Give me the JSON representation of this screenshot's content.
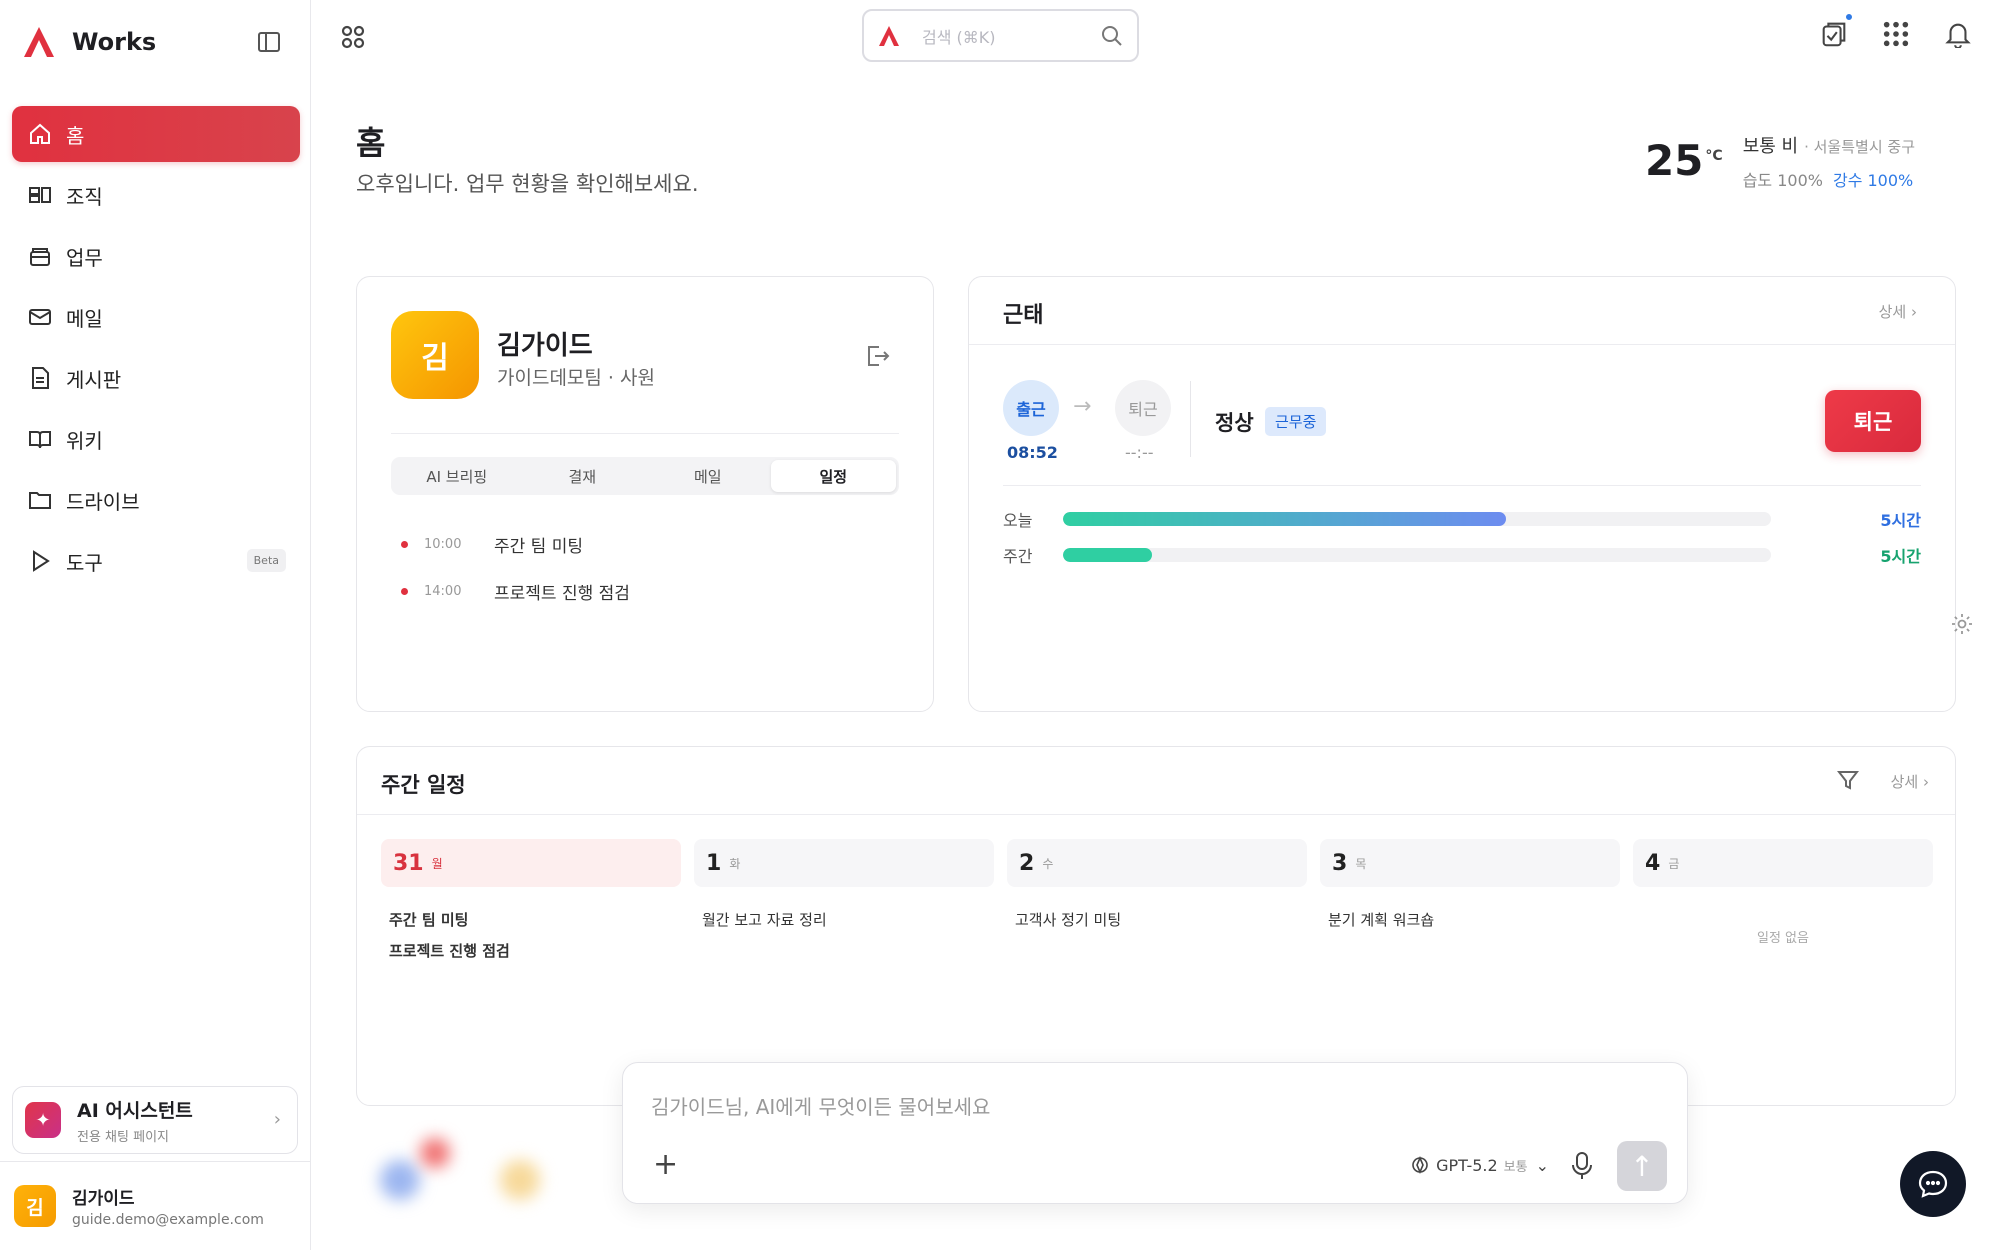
{
  "app": {
    "name": "Works"
  },
  "sidebar": {
    "items": [
      {
        "label": "홈",
        "icon": "home-icon",
        "active": true
      },
      {
        "label": "조직",
        "icon": "org-icon"
      },
      {
        "label": "업무",
        "icon": "task-icon"
      },
      {
        "label": "메일",
        "icon": "mail-icon"
      },
      {
        "label": "게시판",
        "icon": "board-icon"
      },
      {
        "label": "위키",
        "icon": "wiki-icon"
      },
      {
        "label": "드라이브",
        "icon": "folder-icon"
      },
      {
        "label": "도구",
        "icon": "play-icon",
        "badge": "Beta"
      }
    ],
    "assistant": {
      "title": "AI 어시스턴트",
      "subtitle": "전용 채팅 페이지"
    },
    "user": {
      "avatar": "김",
      "name": "김가이드",
      "email": "guide.demo@example.com"
    }
  },
  "topbar": {
    "search_placeholder": "검색 (⌘K)"
  },
  "page": {
    "title": "홈",
    "subtitle": "오후입니다. 업무 현황을 확인해보세요."
  },
  "weather": {
    "temp": "25",
    "unit": "°C",
    "condition": "보통 비",
    "location": "· 서울특별시 중구",
    "humidity": "습도 100%",
    "precip": "강수 100%"
  },
  "profile": {
    "avatar": "김",
    "name": "김가이드",
    "team": "가이드데모팀 · 사원",
    "tabs": [
      "AI 브리핑",
      "결재",
      "메일",
      "일정"
    ],
    "active_tab": "일정",
    "schedule": [
      {
        "time": "10:00",
        "title": "주간 팀 미팅"
      },
      {
        "time": "14:00",
        "title": "프로젝트 진행 점검"
      }
    ]
  },
  "attendance": {
    "title": "근태",
    "more": "상세 ›",
    "in_label": "출근",
    "in_time": "08:52",
    "out_label": "퇴근",
    "out_time": "--:--",
    "status": "정상",
    "status_badge": "근무중",
    "leave_button": "퇴근",
    "today_label": "오늘",
    "today_value": "5시간",
    "today_progress": 0.625,
    "week_label": "주간",
    "week_value": "5시간",
    "week_progress": 0.125,
    "colors": {
      "today_start": "#2fcfa2",
      "today_end": "#6d8cf0",
      "week": "#2fcfa2",
      "today_text": "#2f6fe0",
      "week_text": "#17a36f"
    }
  },
  "weekly": {
    "title": "주간 일정",
    "more": "상세 ›",
    "days": [
      {
        "num": "31",
        "day": "월",
        "events": [
          "주간 팀 미팅",
          "프로젝트 진행 점검"
        ],
        "today": true
      },
      {
        "num": "1",
        "day": "화",
        "events": [
          "월간 보고 자료 정리"
        ]
      },
      {
        "num": "2",
        "day": "수",
        "events": [
          "고객사 정기 미팅"
        ]
      },
      {
        "num": "3",
        "day": "목",
        "events": [
          "분기 계획 워크숍"
        ]
      },
      {
        "num": "4",
        "day": "금",
        "events": [],
        "empty": "일정 없음"
      }
    ]
  },
  "chat": {
    "placeholder": "김가이드님, AI에게 무엇이든 물어보세요",
    "model": "GPT-5.2",
    "level": "보통"
  },
  "accent": "#e0313f"
}
